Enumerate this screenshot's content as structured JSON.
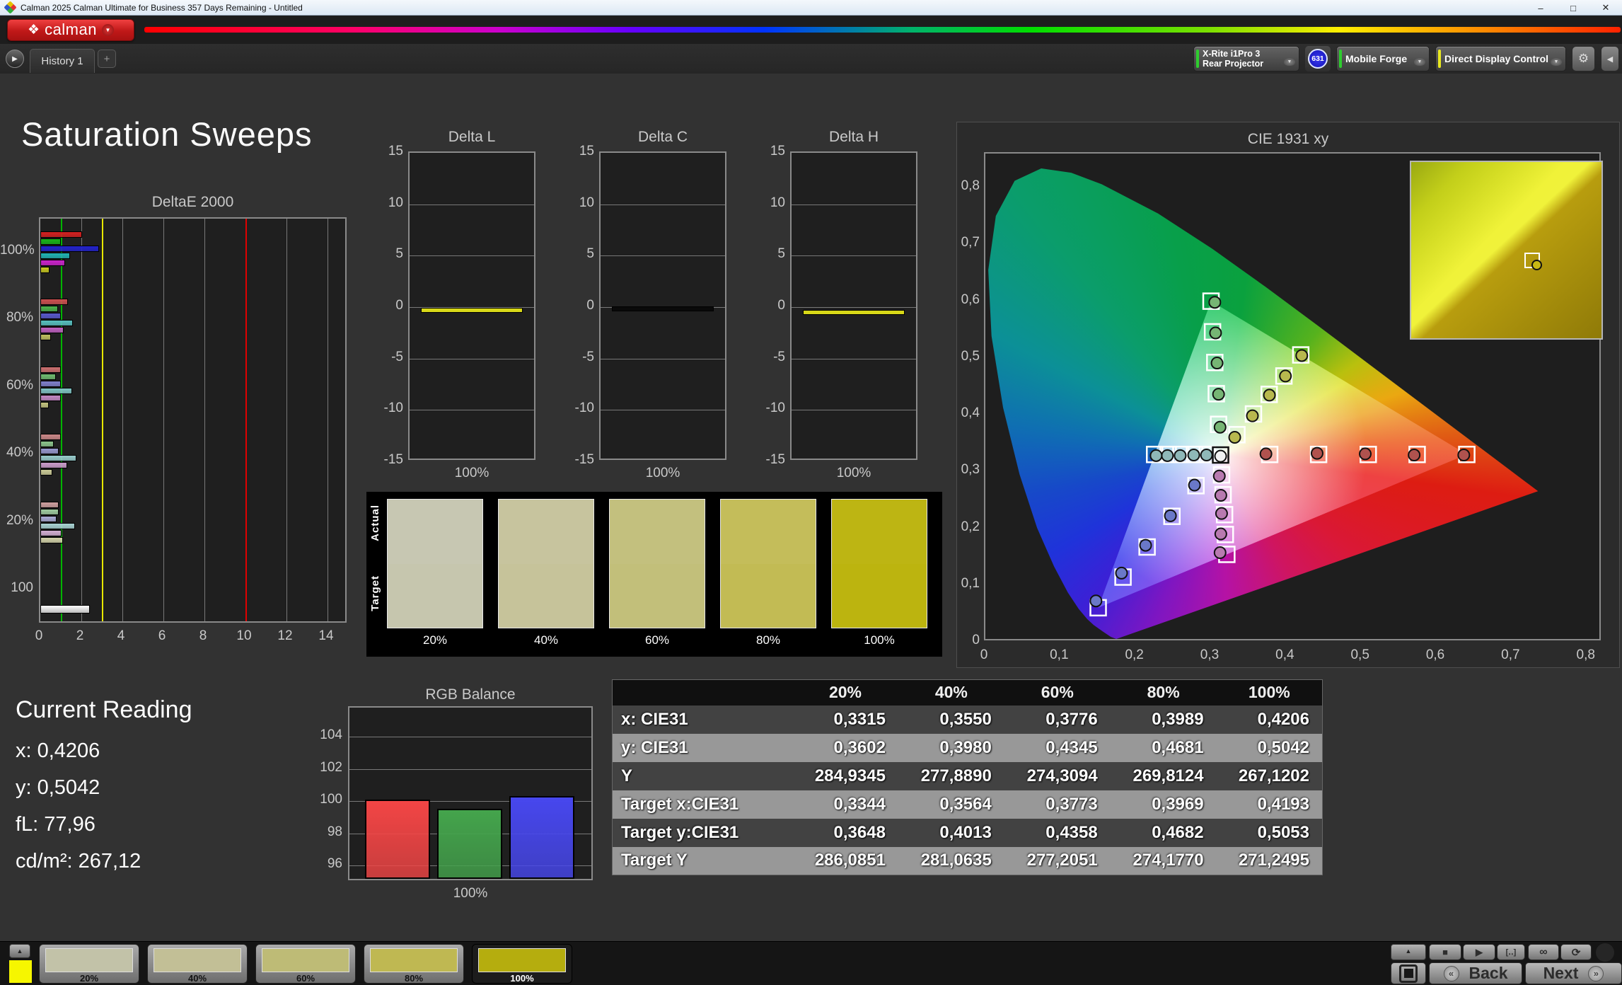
{
  "window": {
    "title": "Calman 2025 Calman Ultimate for Business 357 Days Remaining  - Untitled",
    "minimize": "–",
    "maximize": "□",
    "close": "✕"
  },
  "brand": {
    "logo_text": "calman",
    "diamond_glyph": "❖",
    "chevron": "▼"
  },
  "tabs": {
    "expand_glyph": "▶",
    "history_label": "History 1",
    "add_label": "+"
  },
  "toolbar": {
    "meter": {
      "line1": "X-Rite i1Pro 3",
      "line2": "Rear Projector",
      "stripe": "#2ecc2e",
      "badge": "631"
    },
    "source": {
      "label": "Mobile Forge",
      "stripe": "#2ecc2e"
    },
    "display": {
      "label": "Direct Display Control",
      "stripe": "#e8e820"
    },
    "gear_glyph": "⚙",
    "collapse_glyph": "◀",
    "chevron": "▼"
  },
  "page": {
    "title": "Saturation Sweeps"
  },
  "reading": {
    "title": "Current Reading",
    "lines": [
      "x: 0,4206",
      "y: 0,5042",
      "fL: 77,96",
      "cd/m²: 267,12"
    ]
  },
  "nav": {
    "back_label": "Back",
    "next_label": "Next",
    "back_glyph": "«",
    "next_glyph": "»",
    "stop_glyph": "■",
    "play_glyph": "▶",
    "read_glyph": "[‥]",
    "loop_glyph": "∞",
    "refresh_glyph": "⟳",
    "up_glyph": "▲"
  },
  "bottom_bar": {
    "patch_color": "#f6f600",
    "thumbs": [
      {
        "label": "20%",
        "color": "#c2c2a8",
        "selected": false
      },
      {
        "label": "40%",
        "color": "#c2bf96",
        "selected": false
      },
      {
        "label": "60%",
        "color": "#bebb76",
        "selected": false
      },
      {
        "label": "80%",
        "color": "#bfb852",
        "selected": false
      },
      {
        "label": "100%",
        "color": "#b5ad0e",
        "selected": true
      }
    ]
  },
  "chart_data": [
    {
      "name": "deltae2000",
      "type": "bar",
      "title": "DeltaE 2000",
      "xlim": [
        0,
        15
      ],
      "x_ticks": [
        "0",
        "2",
        "4",
        "6",
        "8",
        "10",
        "12",
        "14"
      ],
      "ref_lines": [
        {
          "value": 1,
          "color": "#00b400"
        },
        {
          "value": 3,
          "color": "#e8e800"
        },
        {
          "value": 10,
          "color": "#e00000"
        }
      ],
      "groups": [
        {
          "label": "100%",
          "values": [
            2.05,
            1.0,
            2.85,
            1.45,
            1.2,
            0.45
          ],
          "colors": [
            "#d42020",
            "#18b418",
            "#2222cc",
            "#20b4b4",
            "#cc22cc",
            "#c8c820"
          ]
        },
        {
          "label": "80%",
          "values": [
            1.35,
            0.85,
            1.0,
            1.6,
            1.15,
            0.5
          ],
          "colors": [
            "#cc5050",
            "#4cb44c",
            "#5858cc",
            "#58c0c0",
            "#c060c0",
            "#c0c060"
          ]
        },
        {
          "label": "60%",
          "values": [
            1.0,
            0.75,
            1.0,
            1.55,
            1.0,
            0.4
          ],
          "colors": [
            "#cc7070",
            "#70bc70",
            "#8080cc",
            "#80c4c4",
            "#c488c4",
            "#c4c480"
          ]
        },
        {
          "label": "40%",
          "values": [
            1.0,
            0.65,
            0.9,
            1.75,
            1.3,
            0.6
          ],
          "colors": [
            "#cc8888",
            "#8cc48c",
            "#9898d0",
            "#98cccc",
            "#cc9ccc",
            "#cccc98"
          ]
        },
        {
          "label": "20%",
          "values": [
            0.9,
            0.9,
            0.8,
            1.7,
            1.05,
            1.1
          ],
          "colors": [
            "#cfa0a0",
            "#a0cca0",
            "#aaaad4",
            "#aad4d4",
            "#d4b0d4",
            "#d4d4aa"
          ]
        },
        {
          "label": "100",
          "values": [
            2.4
          ],
          "colors": [
            "#f2f2f2"
          ],
          "single": true
        }
      ]
    },
    {
      "name": "deltaL",
      "type": "bar",
      "title": "Delta L",
      "ylim": [
        -15,
        15
      ],
      "y_ticks": [
        "15",
        "10",
        "5",
        "0",
        "-5",
        "-10",
        "-15"
      ],
      "x_label": "100%",
      "value": -0.3,
      "color": "#d8d818"
    },
    {
      "name": "deltaC",
      "type": "bar",
      "title": "Delta C",
      "ylim": [
        -15,
        15
      ],
      "y_ticks": [
        "15",
        "10",
        "5",
        "0",
        "-5",
        "-10",
        "-15"
      ],
      "x_label": "100%",
      "value": -0.15,
      "color": "#0a0a0a"
    },
    {
      "name": "deltaH",
      "type": "bar",
      "title": "Delta H",
      "ylim": [
        -15,
        15
      ],
      "y_ticks": [
        "15",
        "10",
        "5",
        "0",
        "-5",
        "-10",
        "-15"
      ],
      "x_label": "100%",
      "value": -0.5,
      "color": "#d8d818"
    },
    {
      "name": "patches",
      "type": "table",
      "row_labels": [
        "Actual",
        "Target"
      ],
      "items": [
        {
          "label": "20%",
          "actual": "#c7c7b2",
          "target": "#c6c6ae"
        },
        {
          "label": "40%",
          "actual": "#c7c49e",
          "target": "#c6c39a"
        },
        {
          "label": "60%",
          "actual": "#c3c07e",
          "target": "#c2bf7a"
        },
        {
          "label": "80%",
          "actual": "#c4bd5a",
          "target": "#c2bb54"
        },
        {
          "label": "100%",
          "actual": "#bdb513",
          "target": "#bcb40f"
        }
      ]
    },
    {
      "name": "cie1931",
      "type": "scatter",
      "title": "CIE 1931 xy",
      "xlim": [
        0,
        0.82
      ],
      "ylim": [
        0,
        0.86
      ],
      "x_ticks": [
        "0",
        "0,1",
        "0,2",
        "0,3",
        "0,4",
        "0,5",
        "0,6",
        "0,7",
        "0,8"
      ],
      "y_ticks": [
        "0",
        "0,1",
        "0,2",
        "0,3",
        "0,4",
        "0,5",
        "0,6",
        "0,7",
        "0,8"
      ],
      "white_point": {
        "target": [
          0.3127,
          0.329
        ],
        "measured": [
          0.3127,
          0.327
        ],
        "fill": "#f2f2f2"
      },
      "sweeps": [
        {
          "name": "red",
          "fill": "#b0524e",
          "targets": [
            [
              0.378,
              0.33
            ],
            [
              0.443,
              0.33
            ],
            [
              0.509,
              0.33
            ],
            [
              0.574,
              0.33
            ],
            [
              0.64,
              0.33
            ]
          ],
          "measured": [
            [
              0.373,
              0.331
            ],
            [
              0.441,
              0.332
            ],
            [
              0.505,
              0.331
            ],
            [
              0.57,
              0.329
            ],
            [
              0.636,
              0.329
            ]
          ]
        },
        {
          "name": "green",
          "fill": "#76b574",
          "targets": [
            [
              0.31,
              0.383
            ],
            [
              0.307,
              0.437
            ],
            [
              0.305,
              0.492
            ],
            [
              0.302,
              0.546
            ],
            [
              0.3,
              0.6
            ]
          ],
          "measured": [
            [
              0.312,
              0.378
            ],
            [
              0.31,
              0.436
            ],
            [
              0.308,
              0.491
            ],
            [
              0.306,
              0.544
            ],
            [
              0.305,
              0.598
            ]
          ]
        },
        {
          "name": "blue",
          "fill": "#6a78c8",
          "targets": [
            [
              0.28,
              0.275
            ],
            [
              0.248,
              0.221
            ],
            [
              0.215,
              0.167
            ],
            [
              0.183,
              0.114
            ],
            [
              0.15,
              0.06
            ]
          ],
          "measured": [
            [
              0.278,
              0.276
            ],
            [
              0.246,
              0.222
            ],
            [
              0.213,
              0.17
            ],
            [
              0.181,
              0.121
            ],
            [
              0.147,
              0.072
            ]
          ]
        },
        {
          "name": "cyan",
          "fill": "#8fb8b8",
          "targets": [
            [
              0.295,
              0.33
            ],
            [
              0.278,
              0.33
            ],
            [
              0.26,
              0.33
            ],
            [
              0.243,
              0.33
            ],
            [
              0.225,
              0.33
            ]
          ],
          "measured": [
            [
              0.294,
              0.329
            ],
            [
              0.277,
              0.329
            ],
            [
              0.259,
              0.328
            ],
            [
              0.242,
              0.328
            ],
            [
              0.227,
              0.328
            ]
          ]
        },
        {
          "name": "magenta",
          "fill": "#b87ab0",
          "targets": [
            [
              0.314,
              0.294
            ],
            [
              0.316,
              0.259
            ],
            [
              0.318,
              0.224
            ],
            [
              0.319,
              0.189
            ],
            [
              0.321,
              0.154
            ]
          ],
          "measured": [
            [
              0.311,
              0.292
            ],
            [
              0.313,
              0.258
            ],
            [
              0.314,
              0.226
            ],
            [
              0.313,
              0.19
            ],
            [
              0.312,
              0.157
            ]
          ]
        },
        {
          "name": "yellow",
          "fill": "#b8b84e",
          "targets": [
            [
              0.3344,
              0.3648
            ],
            [
              0.3564,
              0.4013
            ],
            [
              0.3773,
              0.4358
            ],
            [
              0.3969,
              0.4682
            ],
            [
              0.4193,
              0.5053
            ]
          ],
          "measured": [
            [
              0.3315,
              0.3602
            ],
            [
              0.355,
              0.398
            ],
            [
              0.3776,
              0.4345
            ],
            [
              0.3989,
              0.4681
            ],
            [
              0.4206,
              0.5042
            ]
          ]
        }
      ]
    },
    {
      "name": "rgb_balance",
      "type": "bar",
      "title": "RGB Balance",
      "x_label": "100%",
      "ylim": [
        95,
        105.8
      ],
      "y_ticks": [
        "104",
        "102",
        "100",
        "98",
        "96"
      ],
      "tick_values": [
        104,
        102,
        100,
        98,
        96
      ],
      "series": [
        {
          "name": "Red",
          "value": 99.9,
          "color": "#f24545"
        },
        {
          "name": "Green",
          "value": 99.35,
          "color": "#44a44c"
        },
        {
          "name": "Blue",
          "value": 100.15,
          "color": "#4747ee"
        }
      ]
    },
    {
      "name": "measurements",
      "type": "table",
      "columns": [
        "",
        "20%",
        "40%",
        "60%",
        "80%",
        "100%"
      ],
      "rows": [
        {
          "label": "x: CIE31",
          "values": [
            "0,3315",
            "0,3550",
            "0,3776",
            "0,3989",
            "0,4206"
          ]
        },
        {
          "label": "y: CIE31",
          "values": [
            "0,3602",
            "0,3980",
            "0,4345",
            "0,4681",
            "0,5042"
          ]
        },
        {
          "label": "Y",
          "values": [
            "284,9345",
            "277,8890",
            "274,3094",
            "269,8124",
            "267,1202"
          ]
        },
        {
          "label": "Target x:CIE31",
          "values": [
            "0,3344",
            "0,3564",
            "0,3773",
            "0,3969",
            "0,4193"
          ]
        },
        {
          "label": "Target y:CIE31",
          "values": [
            "0,3648",
            "0,4013",
            "0,4358",
            "0,4682",
            "0,5053"
          ]
        },
        {
          "label": "Target Y",
          "values": [
            "286,0851",
            "281,0635",
            "277,2051",
            "274,1770",
            "271,2495"
          ]
        }
      ]
    }
  ]
}
